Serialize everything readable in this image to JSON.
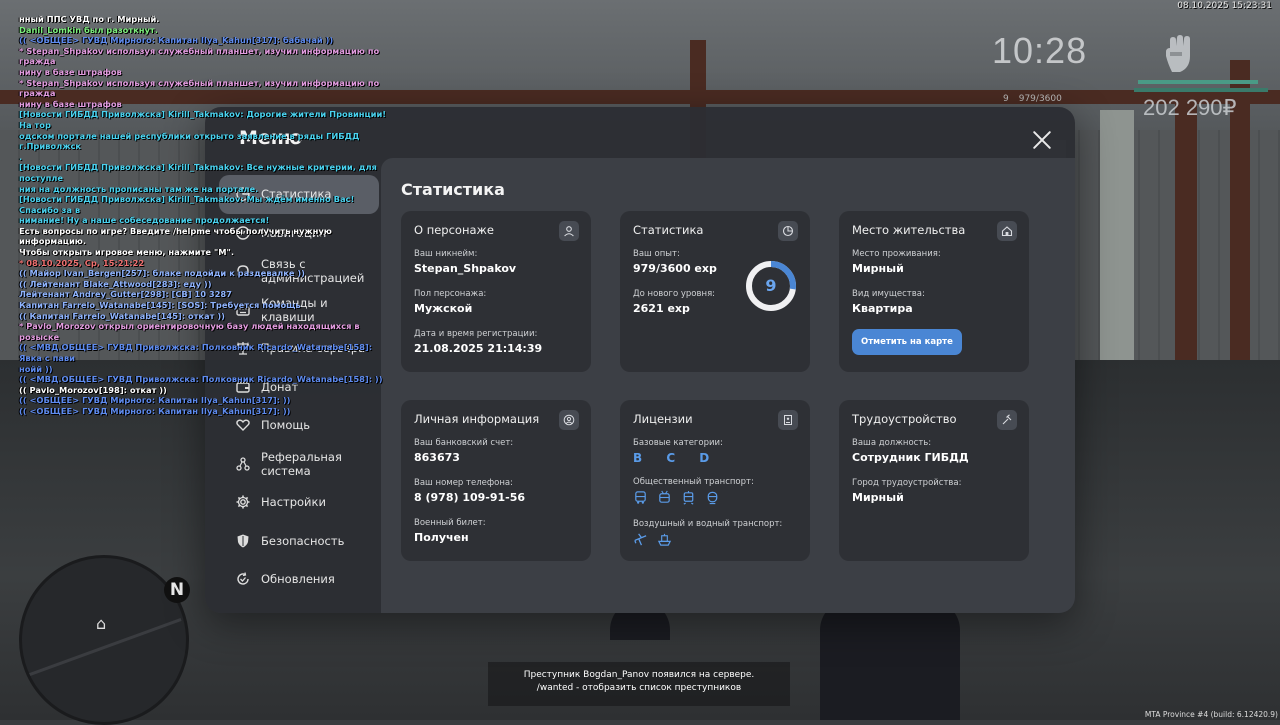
{
  "hud": {
    "datetime": "08.10.2025 15:23:31",
    "clock": "10:28",
    "money": "202 290₽",
    "level": "9",
    "level_exp": "979/3600",
    "build": "MTA Province #4 (build: 6.12420.9)",
    "colors": {
      "health": "#4a9a86",
      "accent": "#4a86d4",
      "exp_ring": "#6aa5ee"
    }
  },
  "chat": [
    {
      "text": "нный ППС УВД по г. Мирный.",
      "color": "#ffffff"
    },
    {
      "text": "Danil_Lomkin был разоткнут.",
      "color": "#7df07d"
    },
    {
      "text": "(( <ОБЩЕЕ> ГУВД Мирного: Капитан Ilya_Kahun[317]: бабачай ))",
      "color": "#5f8cf0"
    },
    {
      "text": "* Stepan_Shpakov используя служебный планшет, изучил информацию по гражда\nнину в базе штрафов",
      "color": "#e39ce0"
    },
    {
      "text": "* Stepan_Shpakov используя служебный планшет, изучил информацию по гражда\nнину в базе штрафов",
      "color": "#e39ce0"
    },
    {
      "text": "[Новости ГИБДД Приволжска] Kirill_Takmakov: Дорогие жители Провинции! На тор\nодском портале нашей республики открыто заявление в ряды ГИБДД г.Приволжск\n.",
      "color": "#4ad3f0"
    },
    {
      "text": "[Новости ГИБДД Приволжска] Kirill_Takmakov: Все нужные критерии, для поступле\nния на должность прописаны там же на портале.",
      "color": "#4ad3f0"
    },
    {
      "text": "[Новости ГИБДД Приволжска] Kirill_Takmakov: Мы ждём именно Вас! Спасибо за в\nнимание! Ну а наше собеседование продолжается!",
      "color": "#4ad3f0"
    },
    {
      "text": "Есть вопросы по игре? Введите /helpme чтобы получить нужную информацию.",
      "color": "#ffffff"
    },
    {
      "text": "Чтобы открыть игровое меню, нажмите \"M\".",
      "color": "#ffffff"
    },
    {
      "text": "* 08.10.2025, Ср, 15:21:22",
      "color": "#f07070"
    },
    {
      "text": "(( Майор Ivan_Bergen[257]: блаке подойди к раздевалке ))",
      "color": "#8fb4ff"
    },
    {
      "text": "(( Лейтенант Blake_Attwood[283]: еду ))",
      "color": "#8fb4ff"
    },
    {
      "text": "Лейтенант Andrey_Gutter[298]: [CB] 10 3287",
      "color": "#8fb4ff"
    },
    {
      "text": "Капитан Farrelo_Watanabe[145]: [SOS]: Требуется помощь",
      "color": "#8fb4ff"
    },
    {
      "text": "(( Капитан Farrelo_Watanabe[145]: откат ))",
      "color": "#8fb4ff"
    },
    {
      "text": "* Pavlo_Morozov открыл ориентировочную базу людей находящихся в розыске",
      "color": "#e39ce0"
    },
    {
      "text": "(( <МВД.ОБЩЕЕ> ГУВД Приволжска: Полковник Ricardo_Watanabe[158]: Явка с пави\nнойй ))",
      "color": "#5f8cf0"
    },
    {
      "text": "(( <МВД.ОБЩЕЕ> ГУВД Приволжска: Полковник Ricardo_Watanabe[158]: ))",
      "color": "#5f8cf0"
    },
    {
      "text": "(( Pavlo_Morozov[198]: откат ))",
      "color": "#ffffff"
    },
    {
      "text": "(( <ОБЩЕЕ> ГУВД Мирного: Капитан Ilya_Kahun[317]: ))",
      "color": "#5f8cf0"
    },
    {
      "text": "(( <ОБЩЕЕ> ГУВД Мирного: Капитан Ilya_Kahun[317]: ))",
      "color": "#5f8cf0"
    }
  ],
  "minimap": {
    "compass": "N"
  },
  "notice": {
    "line1": "Преступник Bogdan_Panov появился на сервере.",
    "line2": "/wanted - отобразить список преступников"
  },
  "menu": {
    "title": "Меню",
    "nav": [
      {
        "label": "Статистика",
        "icon": "pie-chart-icon",
        "active": true
      },
      {
        "label": "Навигация",
        "icon": "compass-icon"
      },
      {
        "label": "Связь с администрацией",
        "icon": "headset-icon"
      },
      {
        "label": "Команды и клавиши",
        "icon": "keyboard-icon"
      },
      {
        "label": "Правила сервера",
        "icon": "scales-icon"
      },
      {
        "label": "Донат",
        "icon": "wallet-icon"
      },
      {
        "label": "Помощь",
        "icon": "heart-hand-icon"
      },
      {
        "label": "Реферальная система",
        "icon": "network-icon"
      },
      {
        "label": "Настройки",
        "icon": "gear-icon"
      },
      {
        "label": "Безопасность",
        "icon": "shield-icon"
      },
      {
        "label": "Обновления",
        "icon": "refresh-check-icon"
      }
    ],
    "content_title": "Статистика",
    "cards": {
      "character": {
        "title": "О персонаже",
        "nickname_label": "Ваш никнейм:",
        "nickname": "Stepan_Shpakov",
        "gender_label": "Пол персонажа:",
        "gender": "Мужской",
        "reg_label": "Дата и время регистрации:",
        "reg": "21.08.2025 21:14:39"
      },
      "stats": {
        "title": "Статистика",
        "exp_label": "Ваш опыт:",
        "exp": "979/3600 exp",
        "next_label": "До нового уровня:",
        "next": "2621 exp",
        "level": "9",
        "progress": 0.272
      },
      "residence": {
        "title": "Место жительства",
        "place_label": "Место проживания:",
        "place": "Мирный",
        "property_label": "Вид имущества:",
        "property": "Квартира",
        "button": "Отметить на карте"
      },
      "personal": {
        "title": "Личная информация",
        "bank_label": "Ваш банковский счет:",
        "bank": "863673",
        "phone_label": "Ваш номер телефона:",
        "phone": "8 (978) 109-91-56",
        "military_label": "Военный билет:",
        "military": "Получен"
      },
      "licenses": {
        "title": "Лицензии",
        "base_label": "Базовые категории:",
        "base": "B C D",
        "public_label": "Общественный транспорт:",
        "public_icons": [
          "bus-icon",
          "trolleybus-icon",
          "tram-icon",
          "metro-icon"
        ],
        "air_label": "Воздушный и водный транспорт:",
        "air_icons": [
          "airplane-icon",
          "ship-icon"
        ]
      },
      "job": {
        "title": "Трудоустройство",
        "position_label": "Ваша должность:",
        "position": "Сотрудник ГИБДД",
        "city_label": "Город трудоустройства:",
        "city": "Мирный"
      }
    }
  }
}
